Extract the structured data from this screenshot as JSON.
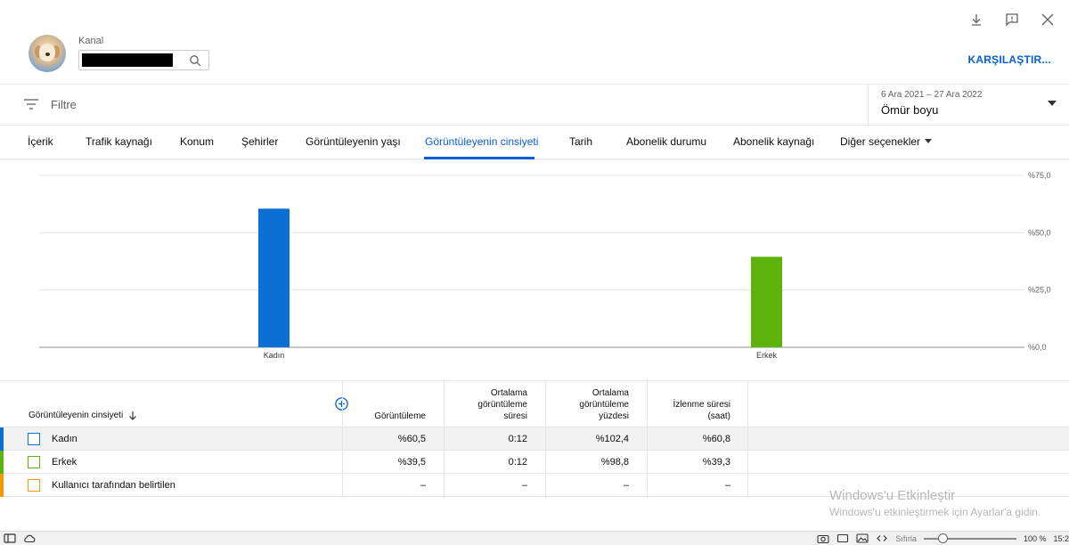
{
  "header": {
    "channel_label": "Kanal",
    "compare_label": "KARŞILAŞTIR..."
  },
  "filter": {
    "placeholder": "Filtre",
    "date_range": "6 Ara 2021 – 27 Ara 2022",
    "date_value": "Ömür boyu"
  },
  "tabs": [
    {
      "label": "İçerik"
    },
    {
      "label": "Trafik kaynağı"
    },
    {
      "label": "Konum"
    },
    {
      "label": "Şehirler"
    },
    {
      "label": "Görüntüleyenin yaşı"
    },
    {
      "label": "Görüntüleyenin cinsiyeti",
      "active": true
    },
    {
      "label": "Tarih"
    },
    {
      "label": "Abonelik durumu"
    },
    {
      "label": "Abonelik kaynağı"
    },
    {
      "label": "Diğer seçenekler"
    }
  ],
  "chart_data": {
    "type": "bar",
    "categories": [
      "Kadın",
      "Erkek"
    ],
    "values": [
      60.5,
      39.5
    ],
    "colors": [
      "#0b6fd3",
      "#5eb20c"
    ],
    "ylim": [
      0,
      75
    ],
    "yticks": [
      0,
      25,
      50,
      75
    ],
    "ytick_labels": [
      "%0,0",
      "%25,0",
      "%50,0",
      "%75,0"
    ],
    "grid": true
  },
  "table": {
    "dimension_header": "Görüntüleyenin cinsiyeti",
    "columns": [
      [
        "Görüntüleme"
      ],
      [
        "Ortalama",
        "görüntüleme",
        "süresi"
      ],
      [
        "Ortalama",
        "görüntüleme",
        "yüzdesi"
      ],
      [
        "İzlenme süresi",
        "(saat)"
      ]
    ],
    "rows": [
      {
        "label": "Kadın",
        "color": "#0b6fd3",
        "values": [
          "%60,5",
          "0:12",
          "%102,4",
          "%60,8"
        ]
      },
      {
        "label": "Erkek",
        "color": "#5eb20c",
        "values": [
          "%39,5",
          "0:12",
          "%98,8",
          "%39,3"
        ]
      },
      {
        "label": "Kullanıcı tarafından belirtilen",
        "color": "#f29900",
        "values": [
          "–",
          "–",
          "–",
          "–"
        ]
      }
    ]
  },
  "watermark": {
    "title": "Windows'u Etkinleştir",
    "subtitle": "Windows'u etkinleştirmek için Ayarlar'a gidin."
  },
  "statusbar": {
    "reset_label": "Sıfırla",
    "zoom": "100 %",
    "time": "15:2"
  }
}
